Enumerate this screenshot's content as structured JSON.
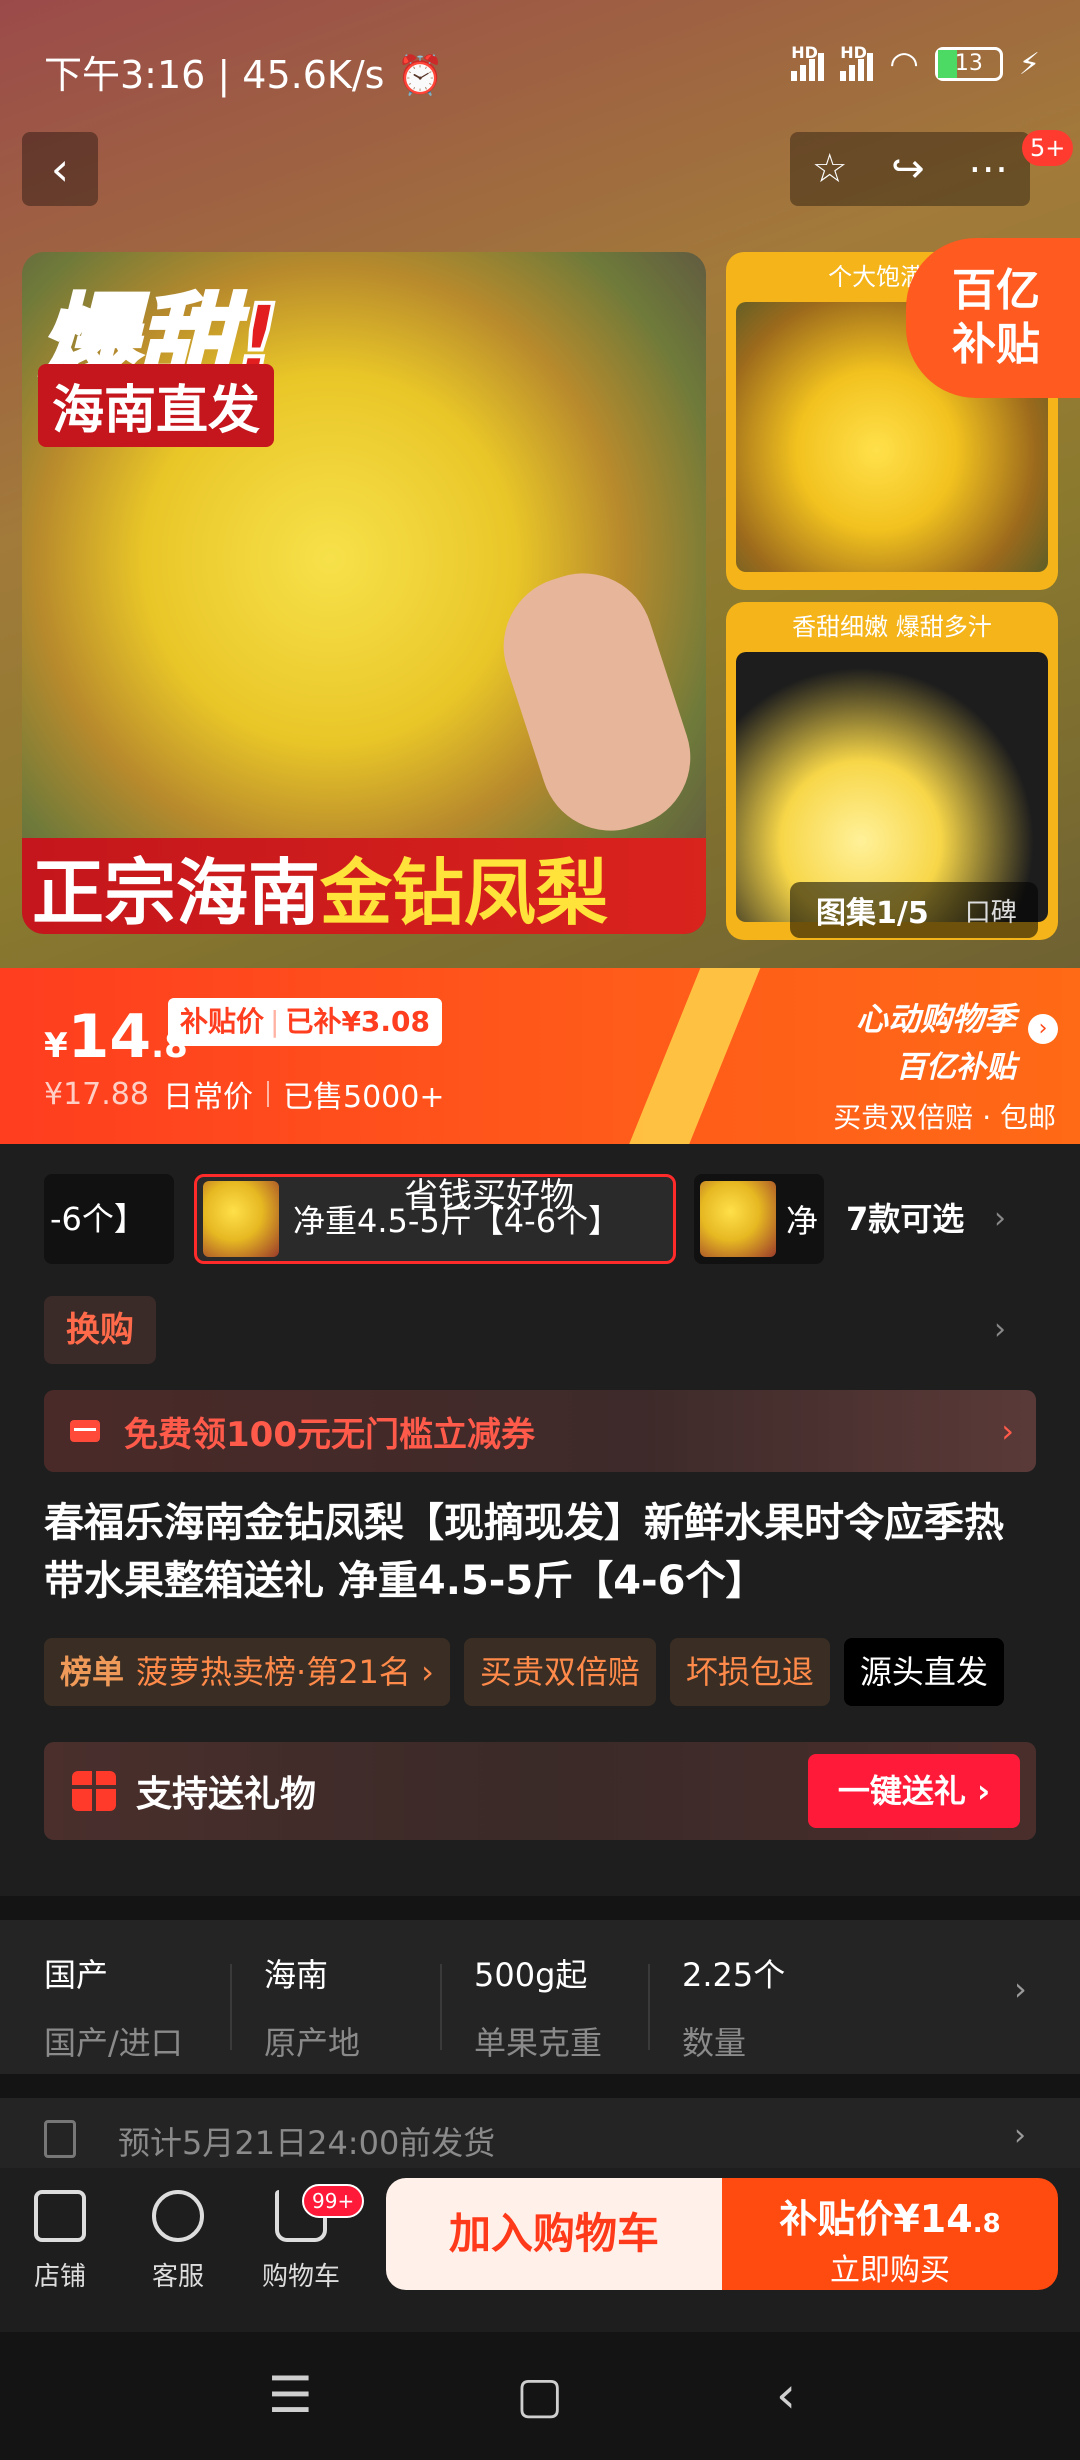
{
  "status_bar": {
    "left": "下午3:16 | 45.6K/s ⏰",
    "hd1": "HD",
    "hd2": "HD",
    "battery": "13"
  },
  "nav": {
    "back_icon": "chevron-left-icon",
    "badge": "5+"
  },
  "hero": {
    "main_title": "爆甜!",
    "main_sub": "海南直发",
    "main_bottom_white": "正宗海南",
    "main_bottom_yellow": "金钻凤梨",
    "side1_caption": "个大饱满  肥",
    "side2_caption": "香甜细嫩  爆甜多汁",
    "subsidy_line1": "百亿",
    "subsidy_line2": "补贴",
    "gallery_label": "图集1/5",
    "reviews_label": "口碑"
  },
  "price": {
    "currency": "¥",
    "integer": "14",
    "decimal": ".8",
    "subsidy_label": "补贴价",
    "subsidy_amount": "已补¥3.08",
    "old_price": "¥17.88",
    "old_label": "日常价",
    "sold": "已售5000+",
    "promo_line1": "心动购物季",
    "promo_line2": "百亿补贴",
    "promo_line3": "买贵双倍赔 · 包邮"
  },
  "sku": {
    "overlay_text": "省钱买好物",
    "prev_label": "-6个】",
    "active_label": "净重4.5-5斤【4-6个】",
    "next_label": "净",
    "more_label": "7款可选"
  },
  "swap": {
    "label": "换购"
  },
  "coupon": {
    "label": "免费领100元无门槛立减券"
  },
  "product_title": "春福乐海南金钻凤梨【现摘现发】新鲜水果时令应季热带水果整箱送礼 净重4.5-5斤【4-6个】",
  "tags": {
    "rank_prefix": "榜单",
    "rank_text": "菠萝热卖榜·第21名 ›",
    "t2": "买贵双倍赔",
    "t3": "坏损包退",
    "t4": "源头直发"
  },
  "gift": {
    "label": "支持送礼物",
    "button": "一键送礼 ›"
  },
  "specs": [
    {
      "value": "国产",
      "key": "国产/进口"
    },
    {
      "value": "海南",
      "key": "原产地"
    },
    {
      "value": "500g起",
      "key": "单果克重"
    },
    {
      "value": "2.25个",
      "key": "数量"
    }
  ],
  "shipping": {
    "label": "预计5月21日24:00前发货"
  },
  "bottom_bar": {
    "shop": "店铺",
    "service": "客服",
    "cart": "购物车",
    "cart_badge": "99+",
    "add_to_cart": "加入购物车",
    "buy_price_prefix": "补贴价¥",
    "buy_price_int": "14",
    "buy_price_dec": ".8",
    "buy_label": "立即购买"
  },
  "colors": {
    "accent": "#ff4a10",
    "price_band": "#ff3d1f",
    "badge_red": "#ff1a3a"
  }
}
